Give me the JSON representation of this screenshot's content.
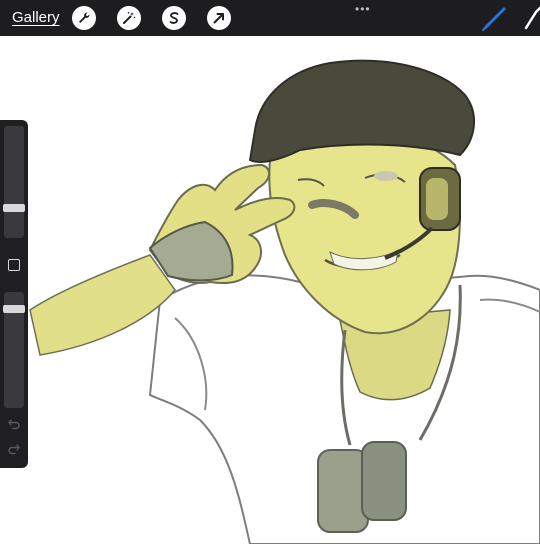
{
  "toolbar": {
    "gallery_label": "Gallery",
    "tools": [
      "wrench-icon",
      "magic-wand-icon",
      "selection-s-icon",
      "transform-arrow-icon"
    ],
    "more_dots": "•••",
    "active_tool": "brush-icon",
    "accent_color": "#2d74d8"
  },
  "sidebar": {
    "brush_size_level": 0.75,
    "opacity_level": 0.12
  },
  "colors": {
    "topbar": "#1d1d1f",
    "skin": "#e4e28a",
    "cap": "#4a4a3c",
    "tag": "#9aa08c"
  }
}
